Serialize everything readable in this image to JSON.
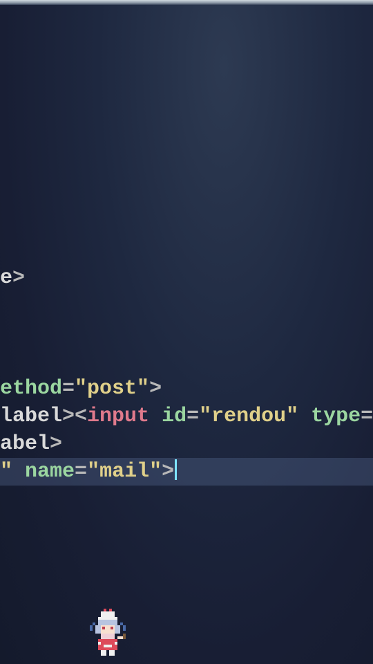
{
  "code": {
    "lines": [
      {
        "type": "blank"
      },
      {
        "type": "blank"
      },
      {
        "type": "blank"
      },
      {
        "type": "blank"
      },
      {
        "type": "blank"
      },
      {
        "type": "blank"
      },
      {
        "type": "blank"
      },
      {
        "type": "blank"
      },
      {
        "type": "blank"
      },
      {
        "segments": [
          {
            "cls": "txt",
            "t": "e"
          },
          {
            "cls": "punc",
            "t": ">"
          }
        ]
      },
      {
        "type": "blank"
      },
      {
        "type": "blank"
      },
      {
        "type": "blank"
      },
      {
        "segments": [
          {
            "cls": "attr",
            "t": "ethod"
          },
          {
            "cls": "punc",
            "t": "="
          },
          {
            "cls": "val",
            "t": "\"post\""
          },
          {
            "cls": "punc",
            "t": ">"
          }
        ]
      },
      {
        "segments": [
          {
            "cls": "txt",
            "t": "label"
          },
          {
            "cls": "punc",
            "t": "><"
          },
          {
            "cls": "tag",
            "t": "input"
          },
          {
            "cls": "txt",
            "t": " "
          },
          {
            "cls": "attr",
            "t": "id"
          },
          {
            "cls": "punc",
            "t": "="
          },
          {
            "cls": "val",
            "t": "\"rendou\""
          },
          {
            "cls": "txt",
            "t": " "
          },
          {
            "cls": "attr",
            "t": "type"
          },
          {
            "cls": "punc",
            "t": "="
          },
          {
            "cls": "val",
            "t": "\""
          }
        ]
      },
      {
        "segments": [
          {
            "cls": "txt",
            "t": "abel"
          },
          {
            "cls": "punc",
            "t": ">"
          }
        ]
      },
      {
        "highlighted": true,
        "cursor": true,
        "segments": [
          {
            "cls": "val",
            "t": "\""
          },
          {
            "cls": "txt",
            "t": " "
          },
          {
            "cls": "attr",
            "t": "name"
          },
          {
            "cls": "punc",
            "t": "="
          },
          {
            "cls": "val",
            "t": "\"mail\""
          },
          {
            "cls": "punc",
            "t": ">"
          }
        ]
      }
    ],
    "lineHeight": 40,
    "topOffset": 22
  },
  "sprite": {
    "name": "remilia-pixel-sprite"
  }
}
